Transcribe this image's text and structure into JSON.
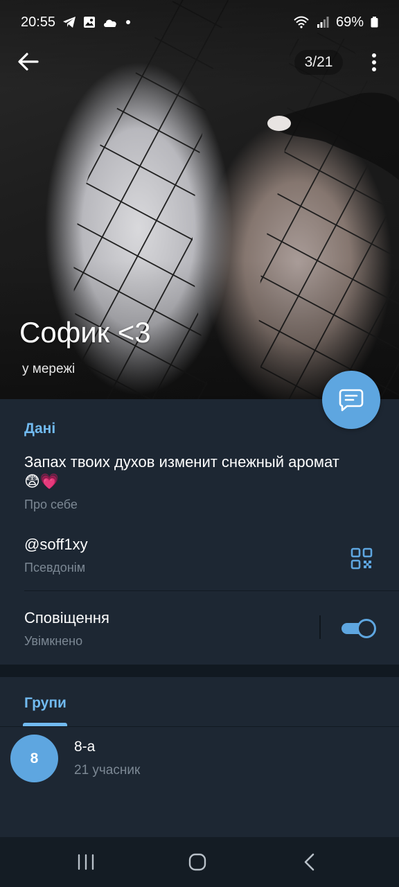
{
  "status_bar": {
    "time": "20:55",
    "battery": "69%"
  },
  "header": {
    "photo_counter": "3/21",
    "name": "Софик <3",
    "status": "у мережі"
  },
  "info": {
    "section_title": "Дані",
    "bio_line1": "Запах твоих духов изменит снежный аромат",
    "bio_emoji": "😨💗",
    "bio_label": "Про себе",
    "username": "@soff1xy",
    "username_label": "Псевдонім",
    "notifications": "Сповіщення",
    "notifications_state": "Увімкнено",
    "notifications_on": true
  },
  "groups": {
    "tab_label": "Групи",
    "items": [
      {
        "avatar_text": "8",
        "name": "8-а",
        "members": "21 учасник"
      }
    ]
  },
  "colors": {
    "accent": "#5ea6e0",
    "section_title": "#71baf0",
    "background": "#1d2733"
  },
  "icons": {
    "back": "arrow-left-icon",
    "menu": "more-vertical-icon",
    "fab": "message-icon",
    "qr": "qr-code-icon",
    "nav_recent": "recent-apps-icon",
    "nav_home": "home-icon",
    "nav_back": "back-icon"
  }
}
